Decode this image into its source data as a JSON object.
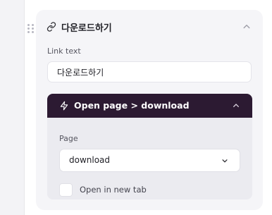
{
  "block": {
    "title": "다운로드하기",
    "title_icon": "link-icon",
    "collapse_icon": "chevron-up-icon"
  },
  "link_text": {
    "label": "Link text",
    "value": "다운로드하기"
  },
  "action": {
    "title": "Open page > download",
    "icon": "lightning-bolt-icon",
    "collapse_icon": "chevron-up-icon",
    "header_color": "#2c1a32",
    "page": {
      "label": "Page",
      "selected": "download",
      "dropdown_icon": "chevron-down-icon"
    },
    "new_tab": {
      "label": "Open in new tab",
      "checked": false
    }
  }
}
